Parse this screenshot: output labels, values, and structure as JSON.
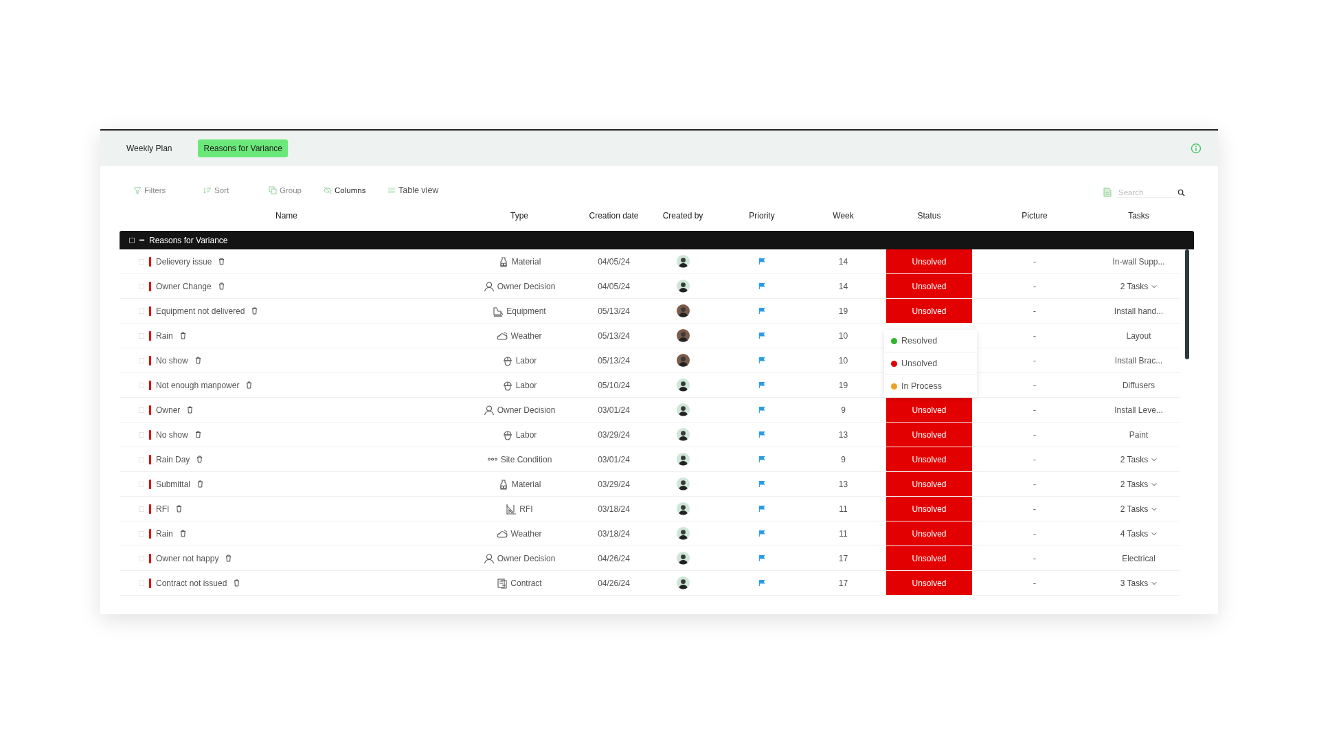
{
  "tabs": [
    {
      "label": "Weekly Plan",
      "selected": false
    },
    {
      "label": "Reasons for Variance",
      "selected": true
    }
  ],
  "toolbar": [
    {
      "label": "Filters",
      "kind": "filter"
    },
    {
      "label": "Sort",
      "kind": "sort"
    },
    {
      "label": "Group",
      "kind": "group"
    },
    {
      "label": "Columns",
      "kind": "columns"
    },
    {
      "label": "Table view",
      "kind": "table"
    }
  ],
  "search": {
    "placeholder": "Search"
  },
  "columns": [
    "Name",
    "Type",
    "Creation date",
    "Created by",
    "Priority",
    "Week",
    "Status",
    "Picture",
    "Tasks"
  ],
  "group": {
    "title": "Reasons for Variance",
    "expanded": true,
    "checked": false
  },
  "rows": [
    {
      "checked": false,
      "name": "Delievery issue",
      "type": {
        "label": "Material",
        "kind": "material"
      },
      "date": "04/05/24",
      "avatar": {
        "kind": "light"
      },
      "week": "14",
      "status": {
        "label": "Unsolved",
        "kind": "unsolved"
      },
      "picture": "-",
      "tasks": "In-wall Supp...",
      "tasks_menu": false
    },
    {
      "checked": false,
      "name": "Owner Change",
      "type": {
        "label": "Owner Decision",
        "kind": "owner"
      },
      "date": "04/05/24",
      "avatar": {
        "kind": "light"
      },
      "week": "14",
      "status": {
        "label": "Unsolved",
        "kind": "unsolved"
      },
      "picture": "-",
      "tasks": "2 Tasks",
      "tasks_menu": true
    },
    {
      "checked": false,
      "name": "Equipment not delivered",
      "type": {
        "label": "Equipment",
        "kind": "equipment"
      },
      "date": "05/13/24",
      "avatar": {
        "kind": "dark"
      },
      "week": "19",
      "status": {
        "label": "Unsolved",
        "kind": "unsolved"
      },
      "picture": "-",
      "tasks": "Install hand...",
      "tasks_menu": false
    },
    {
      "checked": false,
      "name": "Rain",
      "type": {
        "label": "Weather",
        "kind": "weather"
      },
      "date": "05/13/24",
      "avatar": {
        "kind": "dark"
      },
      "week": "10",
      "picture": "-",
      "tasks": "Layout",
      "tasks_menu": false
    },
    {
      "checked": false,
      "name": "No show",
      "type": {
        "label": "Labor",
        "kind": "labor"
      },
      "date": "05/13/24",
      "avatar": {
        "kind": "dark"
      },
      "week": "10",
      "picture": "-",
      "tasks": "Install Brac...",
      "tasks_menu": false
    },
    {
      "checked": false,
      "name": "Not enough manpower",
      "type": {
        "label": "Labor",
        "kind": "labor"
      },
      "date": "05/10/24",
      "avatar": {
        "kind": "light"
      },
      "week": "19",
      "picture": "-",
      "tasks": "Diffusers",
      "tasks_menu": false
    },
    {
      "checked": false,
      "name": "Owner",
      "type": {
        "label": "Owner Decision",
        "kind": "owner"
      },
      "date": "03/01/24",
      "avatar": {
        "kind": "light"
      },
      "week": "9",
      "status": {
        "label": "Unsolved",
        "kind": "unsolved"
      },
      "picture": "-",
      "tasks": "Install Leve...",
      "tasks_menu": false
    },
    {
      "checked": false,
      "name": "No show",
      "type": {
        "label": "Labor",
        "kind": "labor"
      },
      "date": "03/29/24",
      "avatar": {
        "kind": "light"
      },
      "week": "13",
      "status": {
        "label": "Unsolved",
        "kind": "unsolved"
      },
      "picture": "-",
      "tasks": "Paint",
      "tasks_menu": false
    },
    {
      "checked": false,
      "name": "Rain Day",
      "type": {
        "label": "Site Condition",
        "kind": "site"
      },
      "date": "03/01/24",
      "avatar": {
        "kind": "light"
      },
      "week": "9",
      "status": {
        "label": "Unsolved",
        "kind": "unsolved"
      },
      "picture": "-",
      "tasks": "2 Tasks",
      "tasks_menu": true
    },
    {
      "checked": false,
      "name": "Submittal",
      "type": {
        "label": "Material",
        "kind": "material"
      },
      "date": "03/29/24",
      "avatar": {
        "kind": "light"
      },
      "week": "13",
      "status": {
        "label": "Unsolved",
        "kind": "unsolved"
      },
      "picture": "-",
      "tasks": "2 Tasks",
      "tasks_menu": true
    },
    {
      "checked": false,
      "name": "RFI",
      "type": {
        "label": "RFI",
        "kind": "rfi"
      },
      "date": "03/18/24",
      "avatar": {
        "kind": "light"
      },
      "week": "11",
      "status": {
        "label": "Unsolved",
        "kind": "unsolved"
      },
      "picture": "-",
      "tasks": "2 Tasks",
      "tasks_menu": true
    },
    {
      "checked": false,
      "name": "Rain",
      "type": {
        "label": "Weather",
        "kind": "weather"
      },
      "date": "03/18/24",
      "avatar": {
        "kind": "light"
      },
      "week": "11",
      "status": {
        "label": "Unsolved",
        "kind": "unsolved"
      },
      "picture": "-",
      "tasks": "4 Tasks",
      "tasks_menu": true
    },
    {
      "checked": false,
      "name": "Owner not happy",
      "type": {
        "label": "Owner Decision",
        "kind": "owner"
      },
      "date": "04/26/24",
      "avatar": {
        "kind": "light"
      },
      "week": "17",
      "status": {
        "label": "Unsolved",
        "kind": "unsolved"
      },
      "picture": "-",
      "tasks": "Electrical",
      "tasks_menu": false
    },
    {
      "checked": false,
      "name": "Contract not issued",
      "type": {
        "label": "Contract",
        "kind": "contract"
      },
      "date": "04/26/24",
      "avatar": {
        "kind": "light"
      },
      "week": "17",
      "status": {
        "label": "Unsolved",
        "kind": "unsolved"
      },
      "picture": "-",
      "tasks": "3 Tasks",
      "tasks_menu": true
    }
  ],
  "status_menu": {
    "options": [
      {
        "label": "Resolved",
        "color": "#2fb52a"
      },
      {
        "label": "Unsolved",
        "color": "#e00000"
      },
      {
        "label": "In Process",
        "color": "#f0a020"
      }
    ]
  }
}
